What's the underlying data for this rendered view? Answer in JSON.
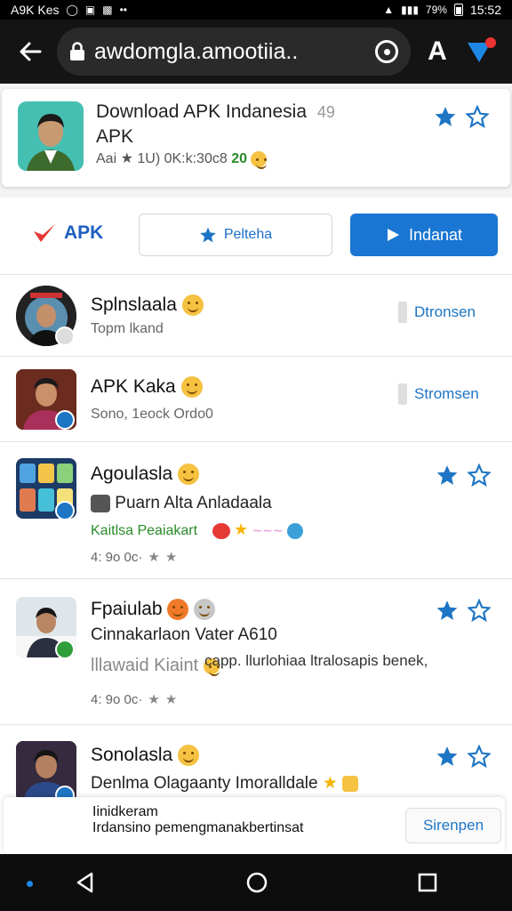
{
  "status_bar": {
    "left_text": "A9K Kes",
    "time": "15:52",
    "battery": "79%"
  },
  "url_bar": {
    "url": "awdomgla.amootiia..",
    "a_label": "A"
  },
  "app": {
    "title": "Download APK Indanesia",
    "title_badge": "49",
    "subtitle": "APK",
    "meta": "Aai ★ 1U) 0K:k:30c8",
    "meta_highlight": "20"
  },
  "actions": {
    "brand": "APK",
    "secondary_label": "Pelteha",
    "primary_label": "Indanat"
  },
  "list": [
    {
      "name": "Splnslaala",
      "line1": "Topm lkand",
      "button": "Dtronsen"
    },
    {
      "name": "APK Kaka",
      "line1": "Sono, 1eock Ordo0",
      "button": "Stromsen"
    },
    {
      "name": "Agoulasla",
      "line1": "Puarn Alta Anladaala",
      "line2": "Kaitlsa Peaiakart",
      "rating": "4: 9o 0c·"
    },
    {
      "name": "Fpaiulab",
      "line1": "Cinnakarlaon Vater A610",
      "line2": "lllawaid Kiaint",
      "line2b": "capp. llurlohiaa ltralosapis benek,",
      "rating": "4: 9o 0c·"
    },
    {
      "name": "Sonolasla",
      "line1": "Denlma Olagaanty Imoralldale"
    }
  ],
  "toast": {
    "line1": "Iinidkeram",
    "line2": "Irdansino pemengmanakbertinsat",
    "button": "Sirenpen"
  },
  "colors": {
    "accent": "#1976d2",
    "star": "#1e75c4",
    "green": "#2a8a2a"
  }
}
